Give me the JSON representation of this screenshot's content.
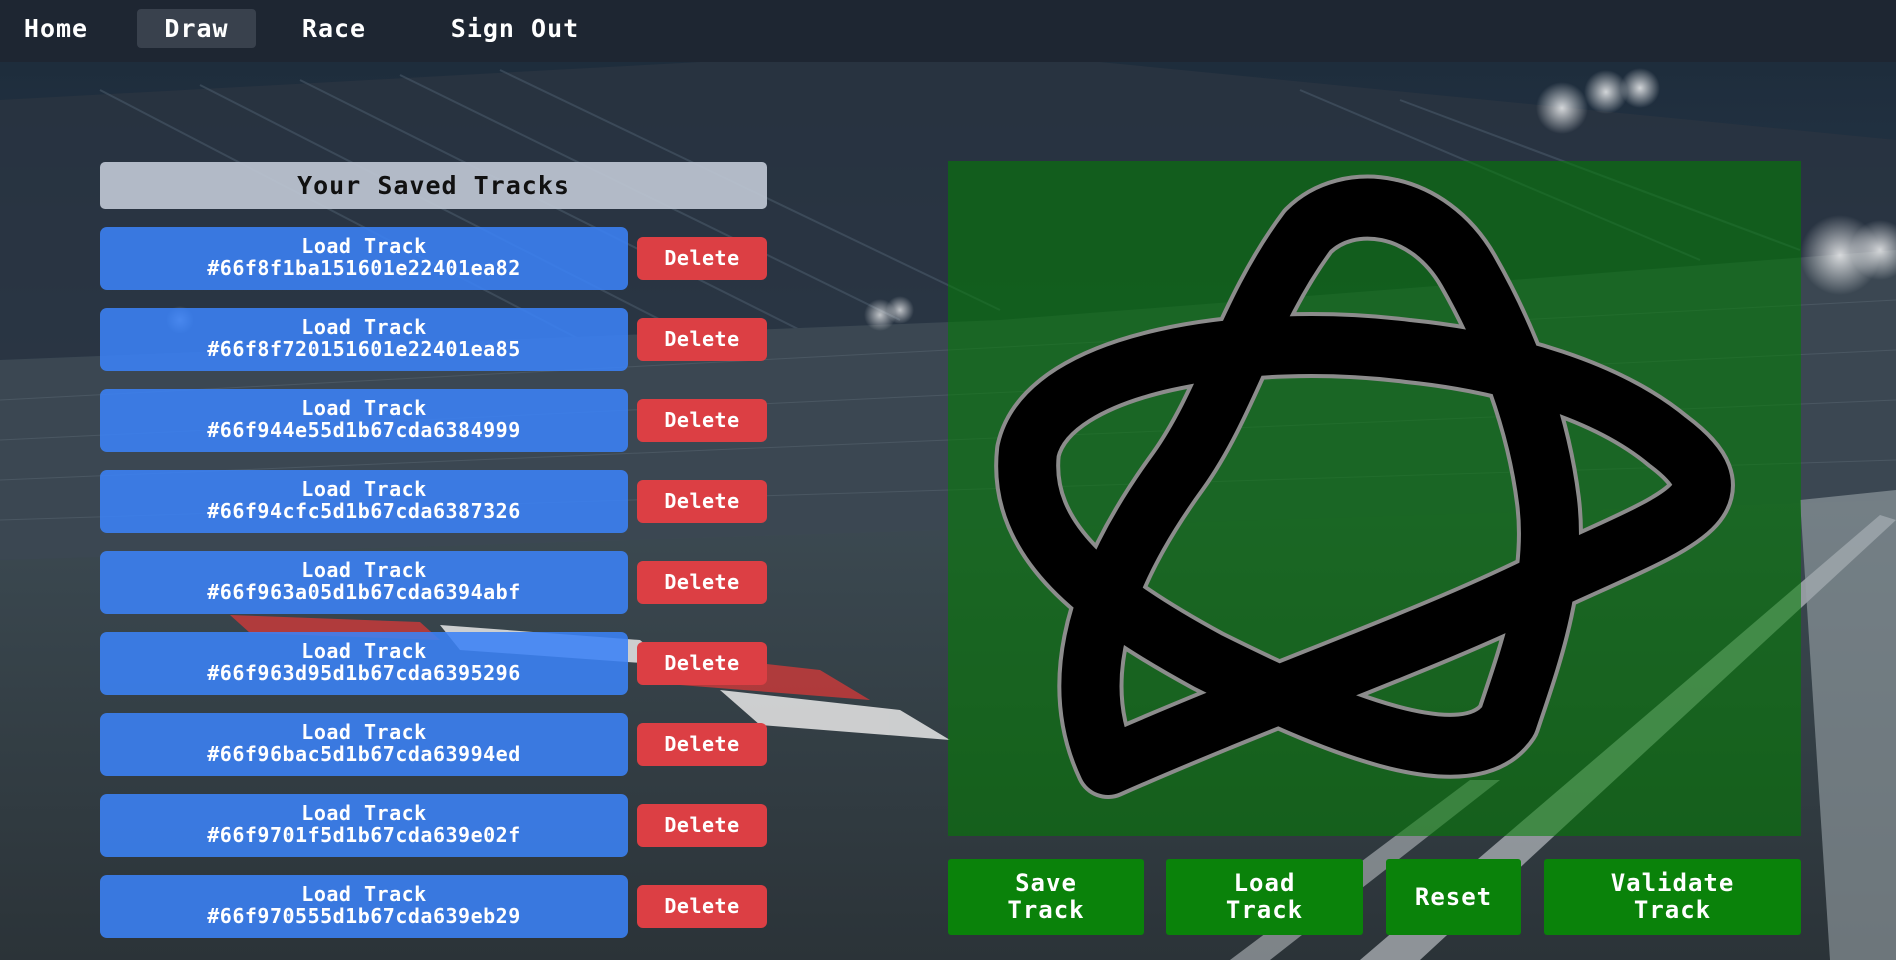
{
  "nav": {
    "items": [
      "Home",
      "Draw",
      "Race",
      "Sign Out"
    ],
    "active": "Draw"
  },
  "saved_tracks": {
    "title": "Your Saved Tracks",
    "load_label": "Load Track",
    "delete_label": "Delete",
    "ids": [
      "#66f8f1ba151601e22401ea82",
      "#66f8f720151601e22401ea85",
      "#66f944e55d1b67cda6384999",
      "#66f94cfc5d1b67cda6387326",
      "#66f963a05d1b67cda6394abf",
      "#66f963d95d1b67cda6395296",
      "#66f96bac5d1b67cda63994ed",
      "#66f9701f5d1b67cda639e02f",
      "#66f970555d1b67cda639eb29"
    ]
  },
  "actions": {
    "save": "Save\nTrack",
    "load": "Load\nTrack",
    "reset": "Reset",
    "validate": "Validate\nTrack"
  },
  "colors": {
    "nav_bg": "#1e2632",
    "load_button": "#3b82f6",
    "delete_button": "#dc3f44",
    "action_button": "#0a820a",
    "canvas_overlay": "#008000",
    "track_stroke": "#000000",
    "track_edge": "#808080"
  }
}
